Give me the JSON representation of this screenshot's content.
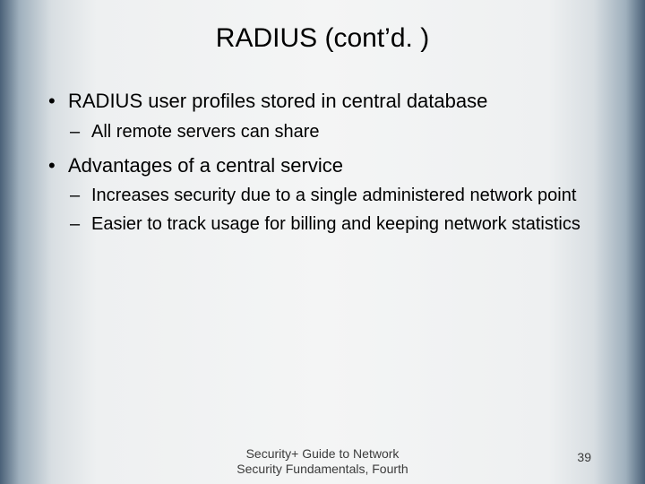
{
  "title": "RADIUS (cont’d. )",
  "bullets": [
    {
      "text": "RADIUS user profiles stored in central database",
      "sub": [
        "All remote servers can share"
      ]
    },
    {
      "text": "Advantages of a central service",
      "sub": [
        "Increases security due to a single administered network point",
        "Easier to track usage for billing and keeping network statistics"
      ]
    }
  ],
  "footer_line1": "Security+ Guide to Network",
  "footer_line2": "Security Fundamentals, Fourth",
  "page_number": "39"
}
